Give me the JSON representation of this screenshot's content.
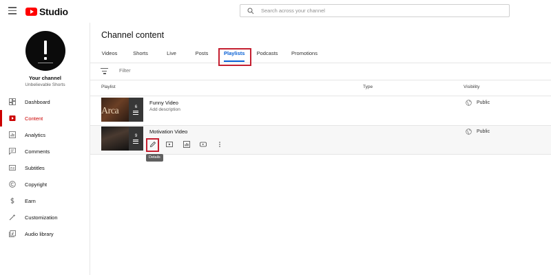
{
  "app": {
    "logo_text": "Studio"
  },
  "search": {
    "placeholder": "Search across your channel"
  },
  "sidebar": {
    "channel_label": "Your channel",
    "channel_name": "Unbelievable Shorts",
    "items": [
      {
        "label": "Dashboard",
        "icon": "dashboard-icon"
      },
      {
        "label": "Content",
        "icon": "content-icon",
        "active": true
      },
      {
        "label": "Analytics",
        "icon": "analytics-icon"
      },
      {
        "label": "Comments",
        "icon": "comments-icon"
      },
      {
        "label": "Subtitles",
        "icon": "subtitles-icon"
      },
      {
        "label": "Copyright",
        "icon": "copyright-icon"
      },
      {
        "label": "Earn",
        "icon": "dollar-icon"
      },
      {
        "label": "Customization",
        "icon": "magic-wand-icon"
      },
      {
        "label": "Audio library",
        "icon": "audio-library-icon"
      }
    ]
  },
  "main": {
    "title": "Channel content",
    "tabs": [
      {
        "label": "Videos"
      },
      {
        "label": "Shorts"
      },
      {
        "label": "Live"
      },
      {
        "label": "Posts"
      },
      {
        "label": "Playlists",
        "active": true
      },
      {
        "label": "Podcasts"
      },
      {
        "label": "Promotions"
      }
    ],
    "filter_placeholder": "Filter",
    "columns": {
      "playlist": "Playlist",
      "type": "Type",
      "visibility": "Visibility"
    },
    "rows": [
      {
        "title": "Funny Video",
        "description": "Add description",
        "count": "6",
        "thumb_text": "Arca",
        "visibility": "Public"
      },
      {
        "title": "Motivation Video",
        "description": "",
        "count": "9",
        "visibility": "Public"
      }
    ],
    "row_actions": [
      "details-icon",
      "play-all-icon",
      "analytics-icon",
      "youtube-icon",
      "more-options-icon"
    ],
    "tooltip": "Details"
  },
  "colors": {
    "accent": "#065fd4",
    "brand": "#ff0000",
    "active_nav": "#cc0000",
    "highlight_box": "#c41e2f"
  }
}
